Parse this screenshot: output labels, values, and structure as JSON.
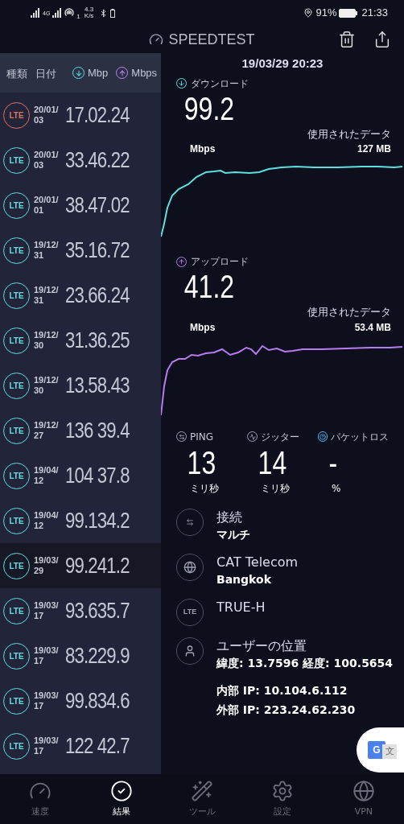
{
  "status_bar": {
    "network": "4G",
    "hotspot_count": "1",
    "speed": "4.3",
    "speed_unit": "K/s",
    "battery": "91%",
    "time": "21:33"
  },
  "header": {
    "title": "SPEEDTEST"
  },
  "history": {
    "columns": [
      {
        "label": "種類",
        "kind": "text"
      },
      {
        "label": "日付",
        "kind": "text"
      },
      {
        "label": "Mbp",
        "kind": "download"
      },
      {
        "label": "Mbps",
        "kind": "upload"
      }
    ],
    "rows": [
      {
        "type": "LTE",
        "color": "#e0735f",
        "date": "20/01/03",
        "speeds": "17.02.24",
        "selected": false
      },
      {
        "type": "LTE",
        "color": "#5ee0e0",
        "date": "20/01/03",
        "speeds": "33.46.22",
        "selected": false
      },
      {
        "type": "LTE",
        "color": "#5ee0e0",
        "date": "20/01/01",
        "speeds": "38.47.02",
        "selected": false
      },
      {
        "type": "LTE",
        "color": "#5ee0e0",
        "date": "19/12/31",
        "speeds": "35.16.72",
        "selected": false
      },
      {
        "type": "LTE",
        "color": "#5ee0e0",
        "date": "19/12/31",
        "speeds": "23.66.24",
        "selected": false
      },
      {
        "type": "LTE",
        "color": "#5ee0e0",
        "date": "19/12/30",
        "speeds": "31.36.25",
        "selected": false
      },
      {
        "type": "LTE",
        "color": "#5ee0e0",
        "date": "19/12/30",
        "speeds": "13.58.43",
        "selected": false
      },
      {
        "type": "LTE",
        "color": "#5ee0e0",
        "date": "19/12/27",
        "speeds": "136 39.4",
        "selected": false
      },
      {
        "type": "LTE",
        "color": "#5ee0e0",
        "date": "19/04/12",
        "speeds": "104 37.8",
        "selected": false
      },
      {
        "type": "LTE",
        "color": "#5ee0e0",
        "date": "19/04/12",
        "speeds": "99.134.2",
        "selected": false
      },
      {
        "type": "LTE",
        "color": "#5ee0e0",
        "date": "19/03/29",
        "speeds": "99.241.2",
        "selected": true
      },
      {
        "type": "LTE",
        "color": "#5ee0e0",
        "date": "19/03/17",
        "speeds": "93.635.7",
        "selected": false
      },
      {
        "type": "LTE",
        "color": "#5ee0e0",
        "date": "19/03/17",
        "speeds": "83.229.9",
        "selected": false
      },
      {
        "type": "LTE",
        "color": "#5ee0e0",
        "date": "19/03/17",
        "speeds": "99.834.6",
        "selected": false
      },
      {
        "type": "LTE",
        "color": "#5ee0e0",
        "date": "19/03/17",
        "speeds": "122 42.7",
        "selected": false
      }
    ]
  },
  "result": {
    "datetime": "19/03/29 20:23",
    "tests": [
      {
        "kind": "download",
        "label": "ダウンロード",
        "value": "99.2",
        "unit": "Mbps",
        "data_label": "使用されたデータ",
        "data_value": "127 MB"
      },
      {
        "kind": "upload",
        "label": "アップロード",
        "value": "41.2",
        "unit": "Mbps",
        "data_label": "使用されたデータ",
        "data_value": "53.4 MB"
      }
    ],
    "stats": [
      {
        "kind": "ping",
        "label": "PING",
        "value": "13",
        "unit": "ミリ秒"
      },
      {
        "kind": "jitter",
        "label": "ジッター",
        "value": "14",
        "unit": "ミリ秒"
      },
      {
        "kind": "loss",
        "label": "パケットロス",
        "value": "-",
        "unit": "%"
      }
    ],
    "info": [
      {
        "kind": "connections",
        "title": "接続",
        "subtitle": "マルチ"
      },
      {
        "kind": "globe",
        "title": "CAT Telecom",
        "subtitle": "Bangkok"
      },
      {
        "kind": "badge",
        "badge": "LTE",
        "title": "TRUE-H"
      },
      {
        "kind": "user",
        "title": "ユーザーの位置",
        "subtitle": "緯度: 13.7596 経度: 100.5654"
      }
    ],
    "ips": [
      "内部 IP: 10.104.6.112",
      "外部 IP: 223.24.62.230"
    ]
  },
  "translate_button": {
    "letter": "G",
    "glyph": "文"
  },
  "nav": [
    {
      "kind": "speed",
      "label": "速度",
      "selected": false
    },
    {
      "kind": "results",
      "label": "結果",
      "selected": true
    },
    {
      "kind": "tools",
      "label": "ツール",
      "selected": false
    },
    {
      "kind": "settings",
      "label": "設定",
      "selected": false
    },
    {
      "kind": "vpn",
      "label": "VPN",
      "selected": false
    }
  ]
}
